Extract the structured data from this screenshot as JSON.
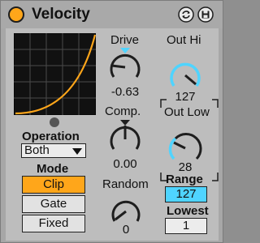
{
  "device": {
    "title": "Velocity",
    "accent_color": "#ffa61a",
    "hot_color": "#4fd4ff",
    "icons": [
      "power-icon",
      "hot-swap-icon",
      "save-icon"
    ]
  },
  "operation": {
    "label": "Operation",
    "selected": "Both"
  },
  "mode": {
    "label": "Mode",
    "buttons": [
      "Clip",
      "Gate",
      "Fixed"
    ],
    "active": "Clip"
  },
  "knobs": {
    "drive": {
      "label": "Drive",
      "value": "-0.63"
    },
    "comp": {
      "label": "Comp.",
      "value": "0.00"
    },
    "random": {
      "label": "Random",
      "value": "0"
    },
    "out_hi": {
      "label": "Out Hi",
      "value": "127"
    },
    "out_low": {
      "label": "Out Low",
      "value": "28"
    }
  },
  "range": {
    "label": "Range",
    "value": "127"
  },
  "lowest": {
    "label": "Lowest",
    "value": "1"
  }
}
